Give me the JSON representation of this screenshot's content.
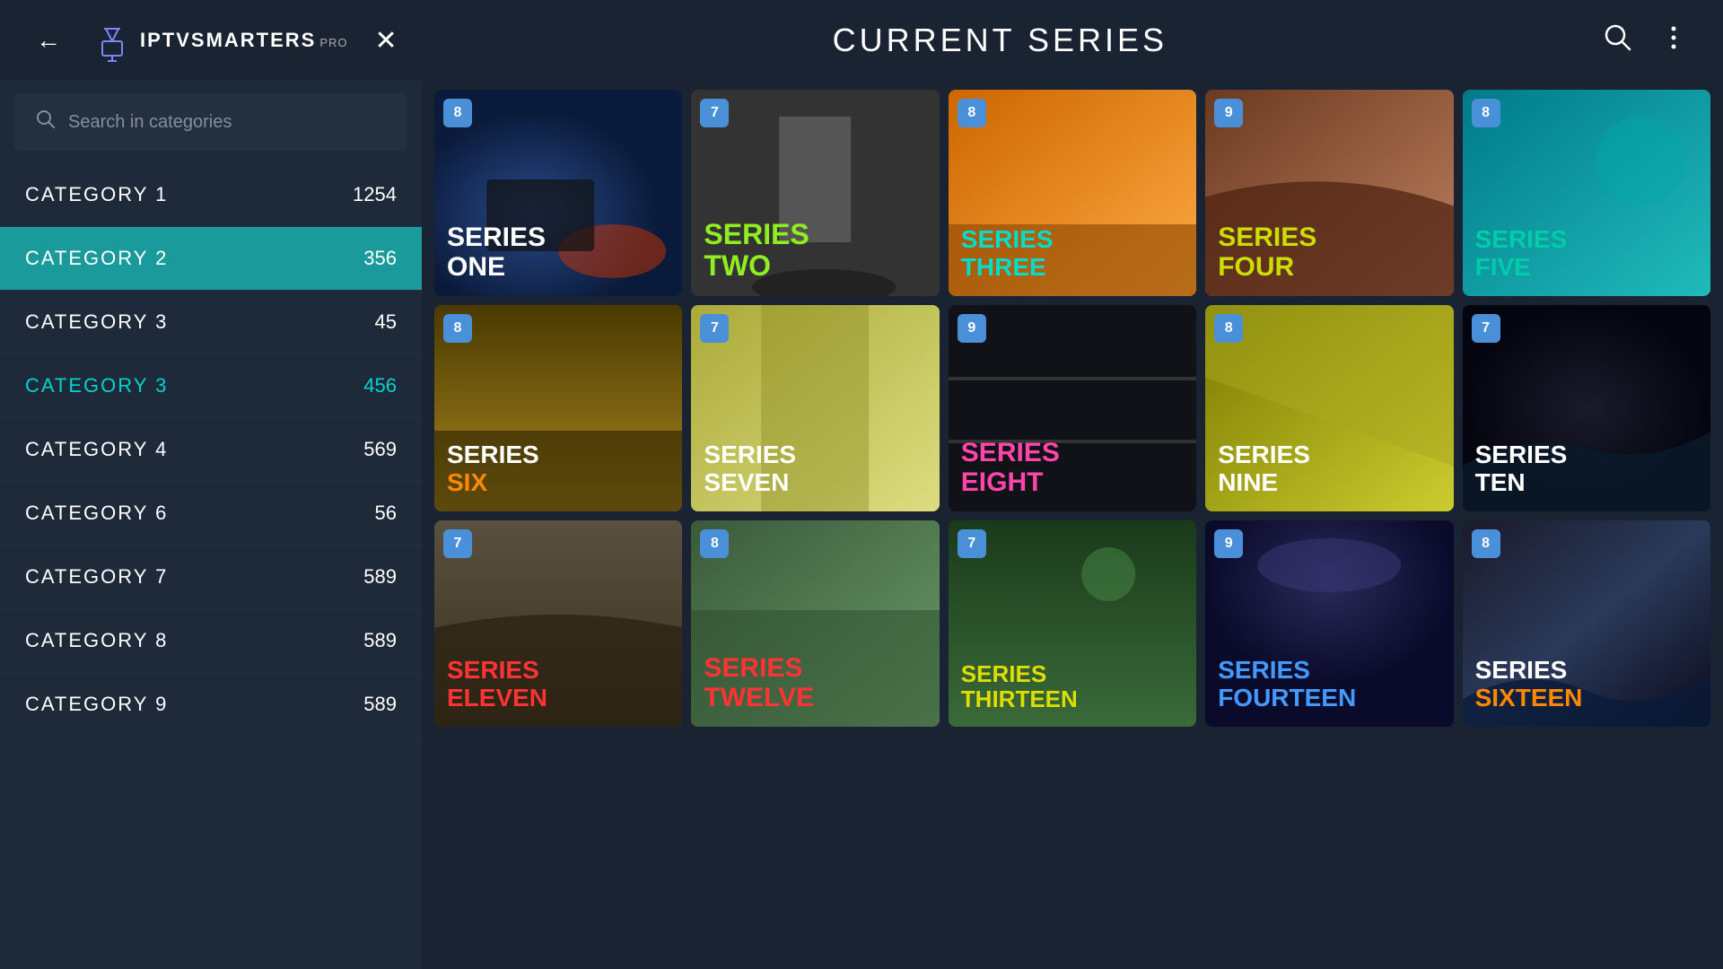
{
  "header": {
    "title": "CURRENT SERIES",
    "back_label": "←",
    "close_label": "✕",
    "logo_iptv": "IPTV",
    "logo_smarters": "SMARTERS",
    "logo_pro": "PRO",
    "search_placeholder": "Search in categories"
  },
  "sidebar": {
    "search_placeholder": "Search in categories",
    "categories": [
      {
        "name": "CATEGORY  1",
        "count": "1254",
        "state": "normal"
      },
      {
        "name": "CATEGORY  2",
        "count": "356",
        "state": "active-teal"
      },
      {
        "name": "CATEGORY  3",
        "count": "45",
        "state": "normal"
      },
      {
        "name": "CATEGORY 3",
        "count": "456",
        "state": "active-highlight"
      },
      {
        "name": "CATEGORY  4",
        "count": "569",
        "state": "normal"
      },
      {
        "name": "CATEGORY  6",
        "count": "56",
        "state": "normal"
      },
      {
        "name": "CATEGORY  7",
        "count": "589",
        "state": "normal"
      },
      {
        "name": "CATEGORY  8",
        "count": "589",
        "state": "normal"
      },
      {
        "name": "CATEGORY  9",
        "count": "589",
        "state": "normal"
      }
    ]
  },
  "series": [
    {
      "id": 1,
      "badge": "8",
      "title": "SERIES\nONE",
      "title_line1": "SERIES",
      "title_line2": "ONE",
      "color_class": "title-white",
      "card_class": "card-1"
    },
    {
      "id": 2,
      "badge": "7",
      "title": "SERIES\nTWO",
      "title_line1": "SERIES",
      "title_line2": "TWO",
      "color_class": "title-green",
      "card_class": "card-2"
    },
    {
      "id": 3,
      "badge": "8",
      "title": "SERIES\nTHREE",
      "title_line1": "SERIES",
      "title_line2": "THREE",
      "color_class": "title-cyan",
      "card_class": "card-3"
    },
    {
      "id": 4,
      "badge": "9",
      "title": "SERIES\nFOUR",
      "title_line1": "SERIES",
      "title_line2": "FOUR",
      "color_class": "title-yellow-green",
      "card_class": "card-4"
    },
    {
      "id": 5,
      "badge": "8",
      "title": "SERIES\nFIVE",
      "title_line1": "SERIES",
      "title_line2": "FIVE",
      "color_class": "title-teal",
      "card_class": "card-5"
    },
    {
      "id": 6,
      "badge": "8",
      "title": "SERIES\nSIX",
      "title_line1": "SERIES",
      "title_line2": "SIX",
      "color_class": "title-orange",
      "card_class": "card-6"
    },
    {
      "id": 7,
      "badge": "7",
      "title": "SERIES\nSEVEN",
      "title_line1": "SERIES",
      "title_line2": "SEVEN",
      "color_class": "title-white-md",
      "card_class": "card-7"
    },
    {
      "id": 8,
      "badge": "9",
      "title": "SERIES\nEIGHT",
      "title_line1": "SERIES",
      "title_line2": "EIGHT",
      "color_class": "title-magenta",
      "card_class": "card-8"
    },
    {
      "id": 9,
      "badge": "8",
      "title": "SERIES\nNINE",
      "title_line1": "SERIES",
      "title_line2": "NINE",
      "color_class": "title-white-lg",
      "card_class": "card-9"
    },
    {
      "id": 10,
      "badge": "7",
      "title": "SERIES\nTEN",
      "title_line1": "SERIES",
      "title_line2": "TEN",
      "color_class": "title-white-sm",
      "card_class": "card-10"
    },
    {
      "id": 11,
      "badge": "7",
      "title": "SERIES\nELEVEN",
      "title_line1": "SERIES",
      "title_line2": "ELEVEN",
      "color_class": "title-red",
      "card_class": "card-11"
    },
    {
      "id": 12,
      "badge": "8",
      "title": "SERIES\nTWELVE",
      "title_line1": "SERIES",
      "title_line2": "TWELVE",
      "color_class": "title-red2",
      "card_class": "card-12"
    },
    {
      "id": 13,
      "badge": "7",
      "title": "SERIES\nTHIRTEEN",
      "title_line1": "SERIES",
      "title_line2": "THIRTEEN",
      "color_class": "title-yellow",
      "card_class": "card-13"
    },
    {
      "id": 14,
      "badge": "9",
      "title": "SERIES\nFOURTEEN",
      "title_line1": "SERIES",
      "title_line2": "FOURTEEN",
      "color_class": "title-blue",
      "card_class": "card-14"
    },
    {
      "id": 15,
      "badge": "8",
      "title": "SERIES\nSIXTEEN",
      "title_line1": "SERIES",
      "title_line2": "SIXTEEN",
      "color_class": "title-orange2",
      "card_class": "card-15"
    }
  ],
  "colors": {
    "accent_teal": "#1a9a9a",
    "highlight_cyan": "#00d4cc",
    "sidebar_bg": "#1e2a3a",
    "main_bg": "#1a2332"
  }
}
